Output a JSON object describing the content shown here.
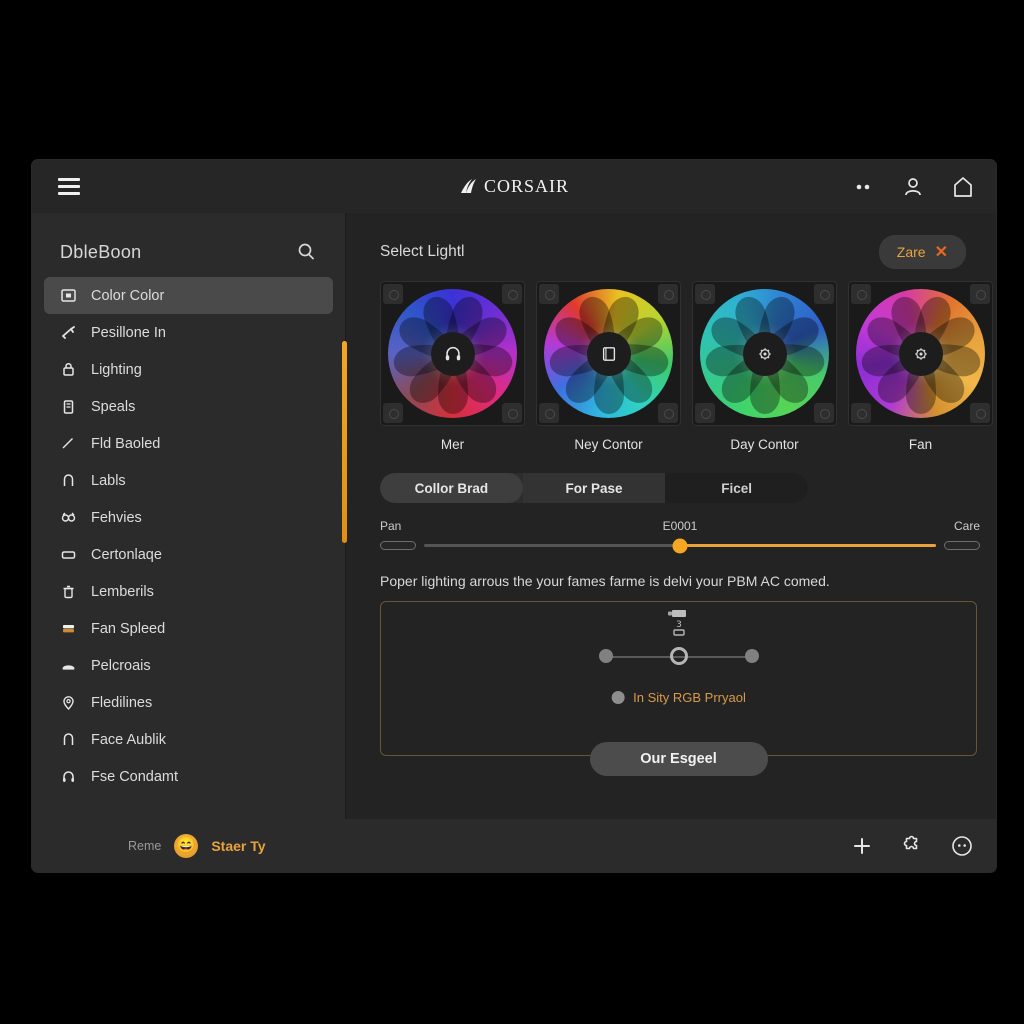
{
  "window": {
    "brand": "CORSAIR",
    "brand_icon": "corsair-sails-icon",
    "menu_icon": "hamburger-menu-icon",
    "titlebar_icons": [
      "more-dots-icon",
      "user-account-icon",
      "home-icon"
    ]
  },
  "sidebar": {
    "title": "DbleBoon",
    "search_icon": "search-icon",
    "items": [
      {
        "label": "Color Color",
        "icon": "square-frame-icon",
        "active": true
      },
      {
        "label": "Pesillone In",
        "icon": "wrench-icon",
        "active": false
      },
      {
        "label": "Lighting",
        "icon": "lock-icon",
        "active": false
      },
      {
        "label": "Speals",
        "icon": "clipboard-icon",
        "active": false
      },
      {
        "label": "Fld Baoled",
        "icon": "pen-icon",
        "active": false
      },
      {
        "label": "Labls",
        "icon": "arch-icon",
        "active": false
      },
      {
        "label": "Fehvies",
        "icon": "goggles-icon",
        "active": false
      },
      {
        "label": "Certonlaqe",
        "icon": "rectangle-icon",
        "active": false
      },
      {
        "label": "Lemberils",
        "icon": "trash-icon",
        "active": false
      },
      {
        "label": "Fan Spleed",
        "icon": "fan-speed-icon",
        "active": false
      },
      {
        "label": "Pelcroais",
        "icon": "mouse-icon",
        "active": false
      },
      {
        "label": "Fledilines",
        "icon": "pin-icon",
        "active": false
      },
      {
        "label": "Face Aublik",
        "icon": "arch-icon",
        "active": false
      },
      {
        "label": "Fse Condamt",
        "icon": "headset-icon",
        "active": false
      }
    ],
    "scrollbar_color": "#f5a623"
  },
  "main": {
    "title": "Select Lightl",
    "zone_pill": {
      "label": "Zare",
      "close_icon": "close-x-icon"
    },
    "devices": [
      {
        "label": "Mer",
        "hub_icon": "headset-icon",
        "colors": [
          "#3b32d6",
          "#6a2fd4",
          "#b431c9",
          "#e02a7a",
          "#d62f3c",
          "#8c4a55",
          "#5a63c4",
          "#2f56c9"
        ]
      },
      {
        "label": "Ney Contor",
        "hub_icon": "monitor-icon",
        "colors": [
          "#e8c321",
          "#b8d430",
          "#3fc96a",
          "#2fd4c2",
          "#2fb6e0",
          "#3f6fe0",
          "#b43ad6",
          "#e0392f"
        ]
      },
      {
        "label": "Day Contor",
        "hub_icon": "gear-icon",
        "colors": [
          "#3fd46a",
          "#36c98e",
          "#2fc2b6",
          "#2fb0d4",
          "#2f7fd4",
          "#2f5ec9",
          "#48c96a",
          "#57d457"
        ]
      },
      {
        "label": "Fan",
        "hub_icon": "gear-icon",
        "colors": [
          "#c33ad6",
          "#d63aa8",
          "#e0742f",
          "#e8a33d",
          "#f0b84a",
          "#d4902f",
          "#b03ad6",
          "#8c2fd4"
        ]
      }
    ],
    "segments": [
      {
        "label": "Collor Brad",
        "state": "selected"
      },
      {
        "label": "For Pase",
        "state": "normal"
      },
      {
        "label": "Ficel",
        "state": "pressed"
      }
    ],
    "slider": {
      "min_label": "Pan",
      "max_label": "Care",
      "value_label": "E0001",
      "fill_percent": 50,
      "accent": "#f5a623"
    },
    "description": "Poper lighting arrous the your fames farme is delvi your PBM AC comed.",
    "panel": {
      "border_color": "#6b5433",
      "node_badge_icon": "device-node-icon",
      "nodes": [
        "node-left",
        "node-center",
        "node-right"
      ],
      "option_label": "In Sity RGB Prryaol",
      "apply_label": "Our Esgeel"
    }
  },
  "footer": {
    "prefix": "Reme",
    "avatar_icon": "grinning-face-avatar",
    "avatar_glyph": "😄",
    "user": "Staer Ty",
    "icons": [
      "plus-icon",
      "puzzle-piece-icon",
      "circle-dots-icon"
    ]
  }
}
